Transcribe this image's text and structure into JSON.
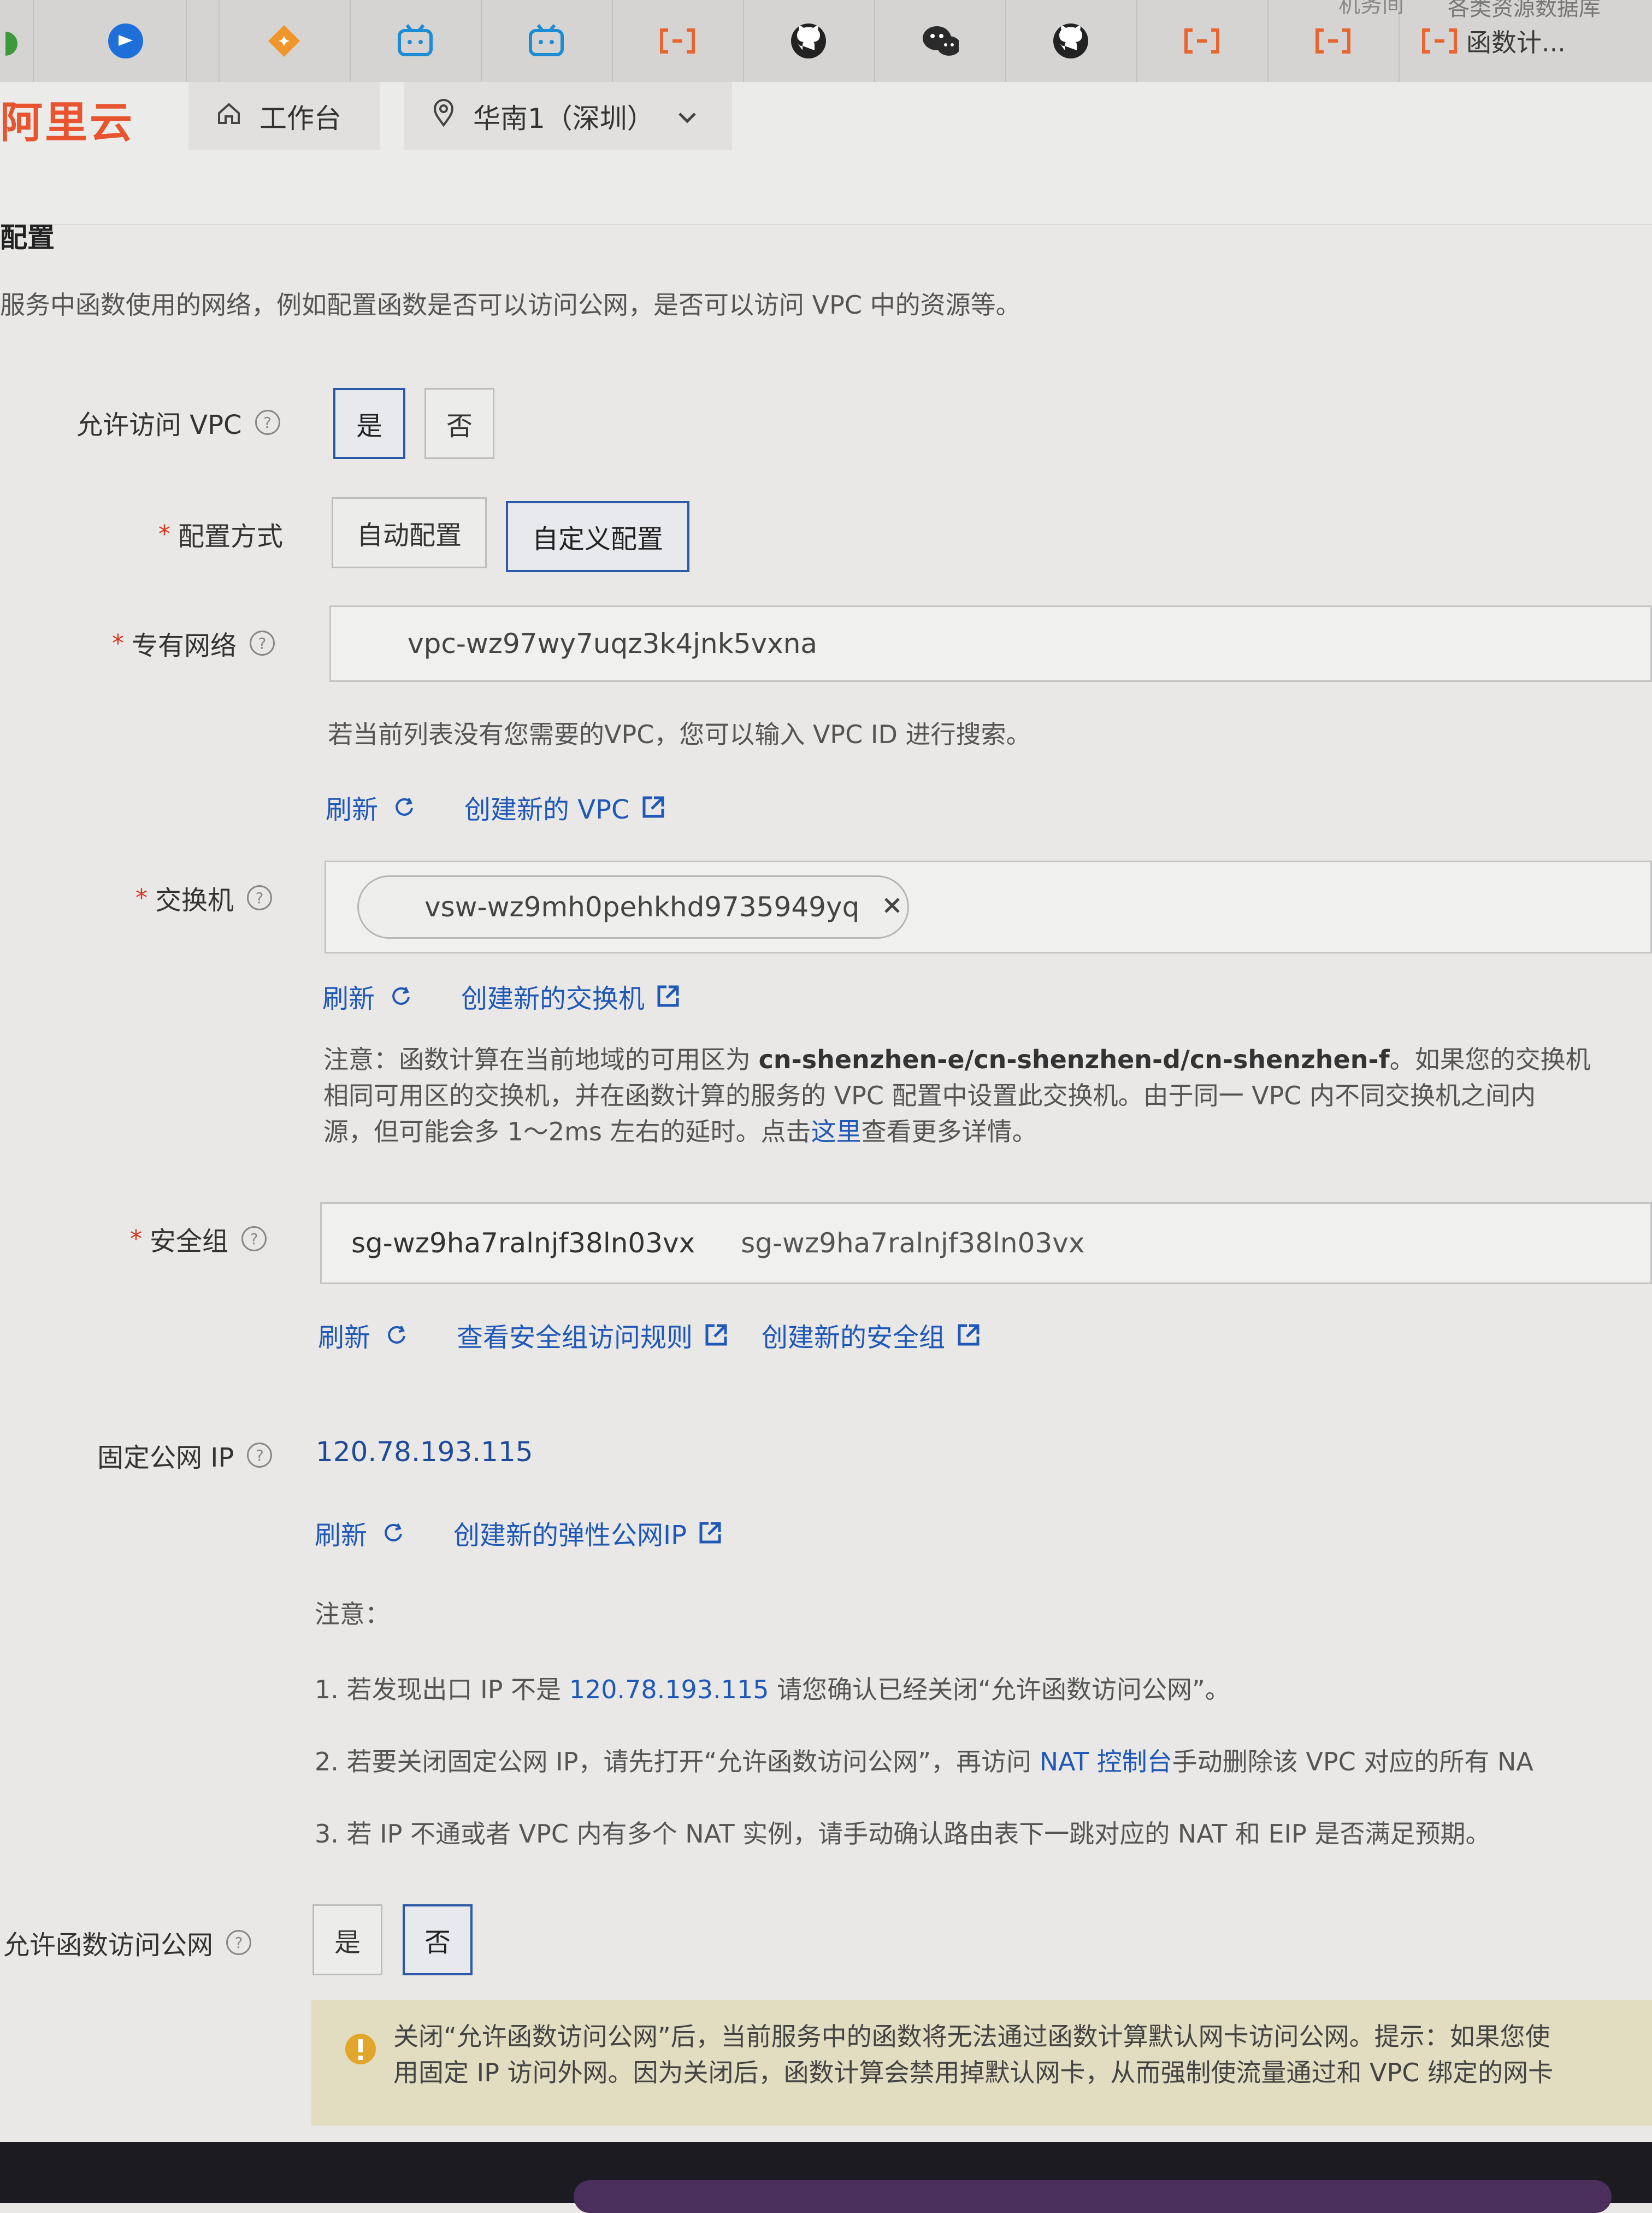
{
  "browser": {
    "tabs": [
      {
        "icon": "bilibili-blue-icon"
      },
      {
        "icon": "orange-diamond-icon"
      },
      {
        "icon": "bilibili-tv-icon"
      },
      {
        "icon": "bilibili-tv-icon"
      },
      {
        "icon": "function-compute-icon"
      },
      {
        "icon": "github-icon"
      },
      {
        "icon": "wechat-icon"
      },
      {
        "icon": "github-icon"
      },
      {
        "icon": "function-compute-icon"
      },
      {
        "icon": "function-compute-icon"
      },
      {
        "icon": "function-compute-icon",
        "title": "函数计..."
      }
    ],
    "top_text_1": "机务间",
    "top_text_2": "各类资源数据库"
  },
  "header": {
    "logo": "阿里云",
    "workbench": "工作台",
    "region": "华南1（深圳）"
  },
  "section": {
    "title": "配置",
    "desc": "服务中函数使用的网络，例如配置函数是否可以访问公网，是否可以访问 VPC 中的资源等。"
  },
  "form": {
    "vpc_access": {
      "label": "允许访问 VPC",
      "yes": "是",
      "no": "否"
    },
    "config_mode": {
      "label": "配置方式",
      "auto": "自动配置",
      "custom": "自定义配置"
    },
    "vpc": {
      "label": "专有网络",
      "value": "vpc-wz97wy7uqz3k4jnk5vxna",
      "hint": "若当前列表没有您需要的VPC，您可以输入 VPC ID 进行搜索。",
      "refresh": "刷新",
      "create": "创建新的 VPC"
    },
    "vswitch": {
      "label": "交换机",
      "value": "vsw-wz9mh0pehkhd9735949yq",
      "refresh": "刷新",
      "create": "创建新的交换机",
      "note_prefix": "注意：函数计算在当前地域的可用区为 ",
      "note_zones": "cn-shenzhen-e/cn-shenzhen-d/cn-shenzhen-f",
      "note_suffix": "。如果您的交换机",
      "note_line2": "相同可用区的交换机，并在函数计算的服务的 VPC 配置中设置此交换机。由于同一 VPC 内不同交换机之间内",
      "note_line3_a": "源，但可能会多 1～2ms 左右的延时。点击",
      "note_line3_link": "这里",
      "note_line3_b": "查看更多详情。"
    },
    "security_group": {
      "label": "安全组",
      "value": "sg-wz9ha7ralnjf38ln03vx",
      "typed": "sg-wz9ha7ralnjf38ln03vx",
      "refresh": "刷新",
      "view_rules": "查看安全组访问规则",
      "create": "创建新的安全组"
    },
    "fixed_ip": {
      "label": "固定公网 IP",
      "value": "120.78.193.115",
      "refresh": "刷新",
      "create": "创建新的弹性公网IP",
      "note_title": "注意：",
      "note1_a": "1. 若发现出口 IP 不是 ",
      "note1_ip": "120.78.193.115",
      "note1_b": " 请您确认已经关闭“允许函数访问公网”。",
      "note2_a": "2. 若要关闭固定公网 IP，请先打开“允许函数访问公网”，再访问 ",
      "note2_link": "NAT 控制台",
      "note2_b": "手动删除该 VPC 对应的所有 NA",
      "note3": "3. 若 IP 不通或者 VPC 内有多个 NAT 实例，请手动确认路由表下一跳对应的 NAT 和 EIP 是否满足预期。"
    },
    "internet_access": {
      "label": "允许函数访问公网",
      "yes": "是",
      "no": "否"
    },
    "warning": {
      "line1": "关闭“允许函数访问公网”后，当前服务中的函数将无法通过函数计算默认网卡访问公网。提示：如果您使",
      "line2": "用固定 IP 访问外网。因为关闭后，函数计算会禁用掉默认网卡，从而强制使流量通过和 VPC 绑定的网卡"
    }
  }
}
